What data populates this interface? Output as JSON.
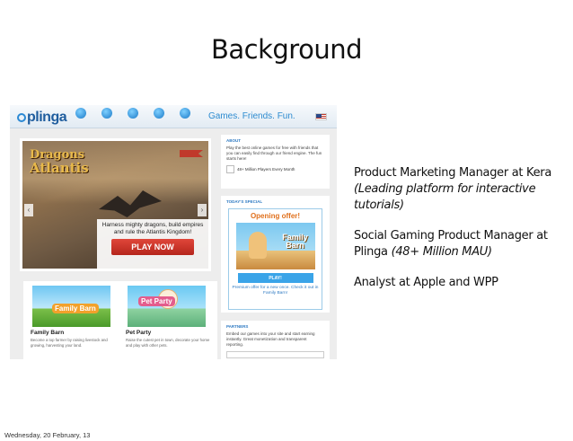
{
  "slide": {
    "title": "Background",
    "footer_date": "Wednesday, 20 February, 13"
  },
  "screenshot": {
    "logo": "plinga",
    "nav_labels": [
      "",
      "",
      "",
      "",
      ""
    ],
    "tagline": "Games. Friends. Fun.",
    "hero": {
      "title_line1": "Dragons",
      "title_line2": "Atlantis",
      "text": "Harness mighty dragons, build empires and rule the Atlantis Kingdom!",
      "button": "PLAY NOW"
    },
    "about": {
      "title": "ABOUT",
      "text": "Play the best online games for free with friends that you can easily find through our friend engine. The fun starts here!",
      "players": "48+ Million Players Every Month"
    },
    "special": {
      "title": "TODAY'S SPECIAL",
      "offer_title": "Opening offer!",
      "offer_logo": "Family Barn",
      "button": "PLAY!",
      "offer_text": "Premium offer for a new once. Check it out in Family Barn!"
    },
    "partners": {
      "title": "PARTNERS",
      "text": "Embed our games into your site and start earning instantly. Great monetization and transparent reporting."
    },
    "games": [
      {
        "name": "Family Barn",
        "logo": "Family Barn",
        "desc": "Become a top farmer by raising livestock and growing, harvesting your land."
      },
      {
        "name": "Pet Party",
        "logo": "Pet Party",
        "desc": "Raise the cutest pet in town, decorate your home and play with other pets."
      }
    ]
  },
  "info": {
    "role1_main": "Product Marketing Manager at Kera ",
    "role1_note": "(Leading platform for interactive tutorials)",
    "role2_main": "Social Gaming Product Manager at Plinga ",
    "role2_note": "(48+ Million MAU)",
    "role3": "Analyst at Apple and WPP"
  }
}
